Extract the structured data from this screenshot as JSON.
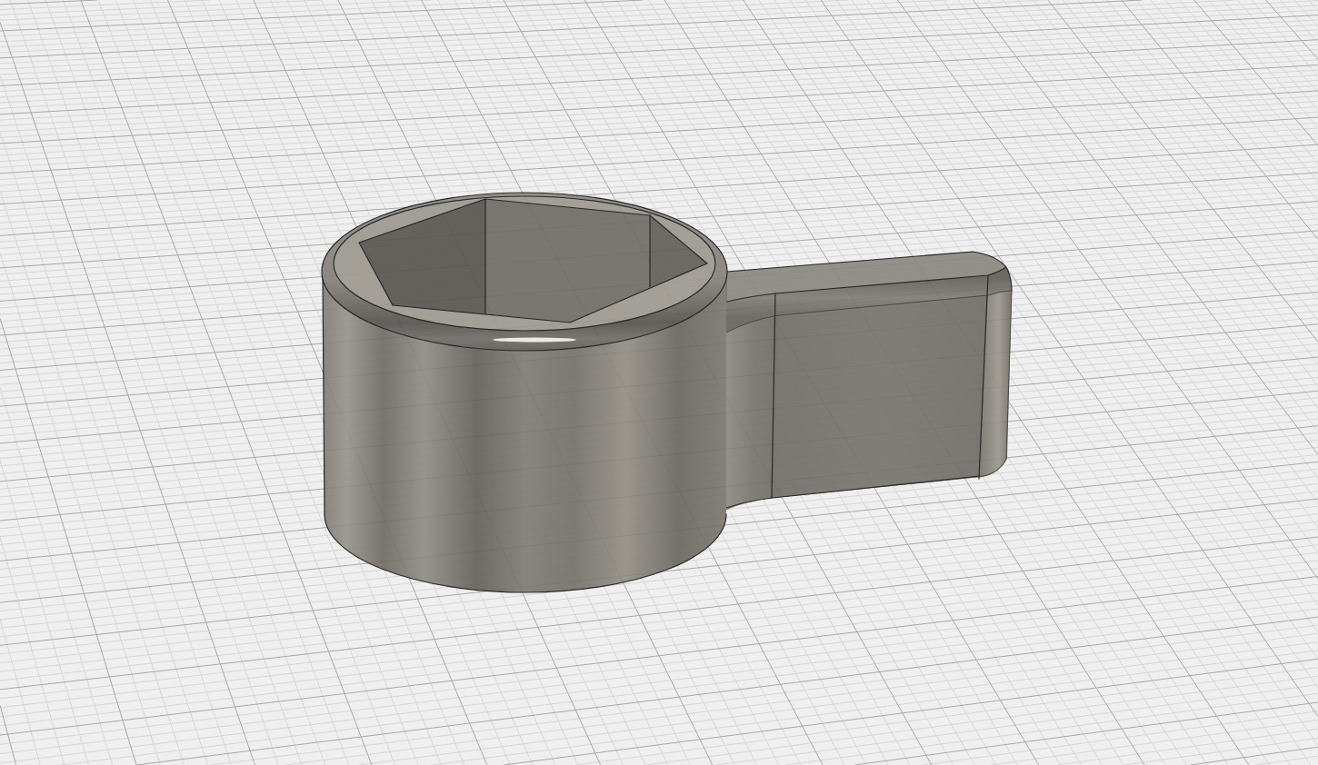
{
  "viewport": {
    "grid": {
      "visible": true
    },
    "part": {
      "visible": true
    }
  }
}
